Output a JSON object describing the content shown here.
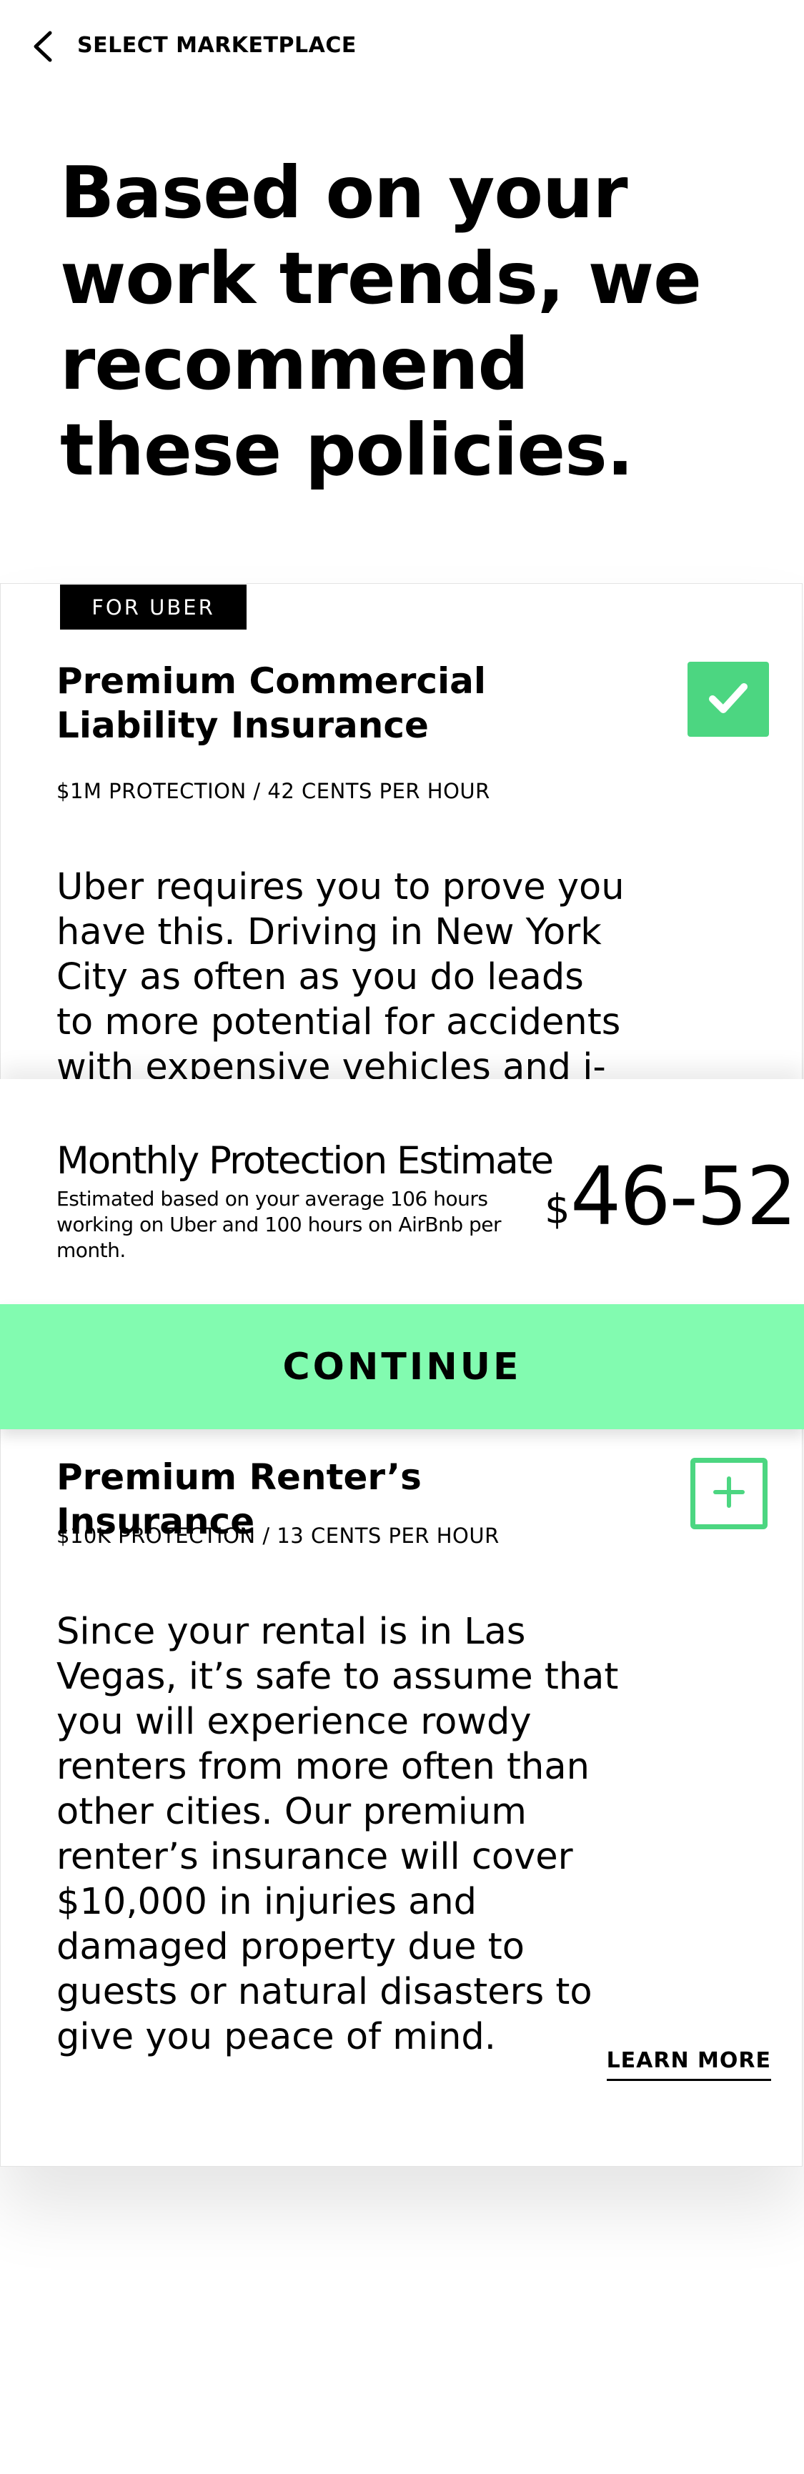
{
  "header": {
    "back_icon": "chevron-left-icon",
    "title": "SELECT MARKETPLACE"
  },
  "headline": "Based on your work trends, we recommend these policies.",
  "colors": {
    "accent_green": "#4cd681",
    "continue_green": "#82fbb0",
    "tag_background": "#000000"
  },
  "policies": [
    {
      "tag": "FOR UBER",
      "title": "Premium Commercial Liability Insurance",
      "subtitle": "$1M PROTECTION / 42 CENTS PER HOUR",
      "description": "Uber requires you to prove you have this. Driving in New York City as often as you do leads to more potential for accidents with expensive vehicles and j-walking",
      "selected": true,
      "action_icon": "checkmark-icon"
    },
    {
      "title": "Premium Renter’s Insurance",
      "subtitle": "$10K PROTECTION / 13 CENTS PER HOUR",
      "description": "Since your rental is in Las Vegas, it’s safe to assume that you will experience rowdy renters from more often than other cities. Our premium renter’s insurance will cover $10,000 in injuries and damaged property due to guests or natural disasters to give you peace of mind.",
      "selected": false,
      "action_icon": "plus-icon",
      "link": "LEARN MORE"
    }
  ],
  "estimate": {
    "title": "Monthly Protection Estimate",
    "note": "Estimated based on your average 106 hours working on Uber and 100 hours on AirBnb per month.",
    "currency": "$",
    "amount": "46-52"
  },
  "continue_label": "CONTINUE"
}
